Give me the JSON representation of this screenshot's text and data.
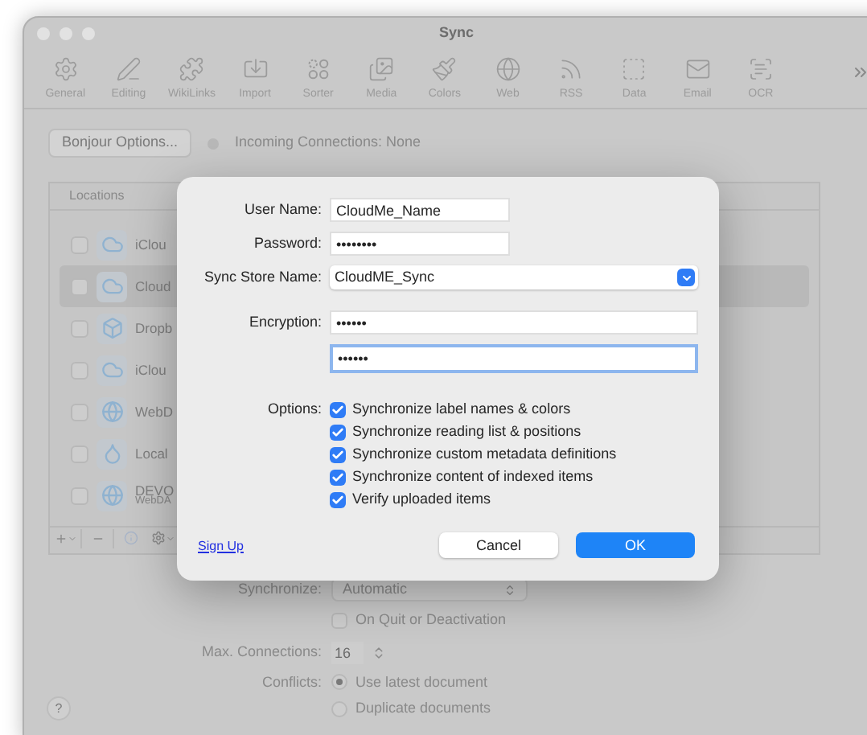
{
  "window": {
    "title": "Sync"
  },
  "toolbar": [
    {
      "label": "General",
      "kind": "gear"
    },
    {
      "label": "Editing",
      "kind": "pen"
    },
    {
      "label": "WikiLinks",
      "kind": "puzzle"
    },
    {
      "label": "Import",
      "kind": "import"
    },
    {
      "label": "Sorter",
      "kind": "sorter"
    },
    {
      "label": "Media",
      "kind": "media"
    },
    {
      "label": "Colors",
      "kind": "brush"
    },
    {
      "label": "Web",
      "kind": "globe"
    },
    {
      "label": "RSS",
      "kind": "rss"
    },
    {
      "label": "Data",
      "kind": "data"
    },
    {
      "label": "Email",
      "kind": "mail"
    },
    {
      "label": "OCR",
      "kind": "ocr"
    }
  ],
  "bonjour_button": "Bonjour Options...",
  "incoming_connections": "Incoming Connections: None",
  "locations": {
    "header": "Locations",
    "items": [
      {
        "name": "iClou",
        "kind": "cloud",
        "checked": false,
        "selected": false
      },
      {
        "name": "Cloud",
        "kind": "cloudme",
        "checked": false,
        "selected": true
      },
      {
        "name": "Dropb",
        "kind": "box",
        "checked": false,
        "selected": false
      },
      {
        "name": "iClou",
        "kind": "cloud",
        "checked": false,
        "selected": false
      },
      {
        "name": "WebD",
        "kind": "globe",
        "checked": false,
        "selected": false
      },
      {
        "name": "Local",
        "kind": "drop",
        "checked": false,
        "selected": false
      },
      {
        "name": "DEVO",
        "subtitle": "WebDA",
        "kind": "globe",
        "checked": false,
        "selected": false
      }
    ]
  },
  "synchronize": {
    "label": "Synchronize:",
    "value": "Automatic"
  },
  "on_quit": {
    "label": "On Quit or Deactivation",
    "checked": false
  },
  "max_connections": {
    "label": "Max. Connections:",
    "value": "16"
  },
  "conflicts": {
    "label": "Conflicts:",
    "options": [
      {
        "label": "Use latest document",
        "selected": true
      },
      {
        "label": "Duplicate documents",
        "selected": false
      }
    ]
  },
  "help_button": "?",
  "dialog": {
    "fields": [
      {
        "label": "User Name:",
        "value": "CloudMe_Name",
        "kind": "short"
      },
      {
        "label": "Password:",
        "value": "••••••••",
        "kind": "short"
      },
      {
        "label": "Sync Store Name:",
        "value": "CloudME_Sync",
        "kind": "select"
      },
      {
        "label": "Encryption:",
        "value": "••••••",
        "kind": "wide"
      },
      {
        "value": "••••••",
        "kind": "wide",
        "focused": true
      }
    ],
    "options_label": "Options:",
    "options": [
      {
        "label": "Synchronize label names & colors",
        "checked": true
      },
      {
        "label": "Synchronize reading list & positions",
        "checked": true
      },
      {
        "label": "Synchronize custom metadata definitions",
        "checked": true
      },
      {
        "label": "Synchronize content of indexed items",
        "checked": true
      },
      {
        "label": "Verify uploaded items",
        "checked": true
      }
    ],
    "sign_up": "Sign Up",
    "cancel": "Cancel",
    "ok": "OK"
  }
}
